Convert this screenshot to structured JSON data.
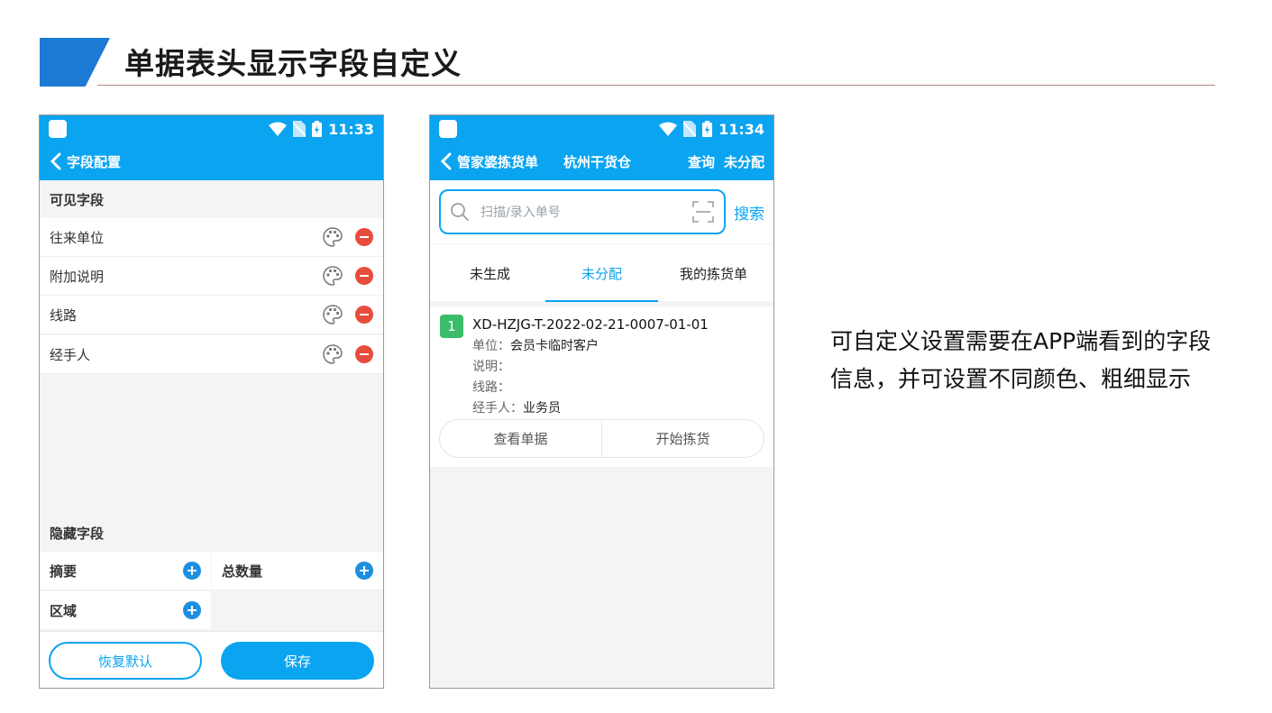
{
  "slide": {
    "title": "单据表头显示字段自定义",
    "description_line1": "可自定义设置需要在APP端看到的字段",
    "description_line2": "信息，并可设置不同颜色、粗细显示",
    "accent_color": "#1a7ad4"
  },
  "phone1": {
    "status_time": "11:33",
    "nav_title": "字段配置",
    "visible_section": "可见字段",
    "visible_fields": [
      {
        "label": "往来单位"
      },
      {
        "label": "附加说明"
      },
      {
        "label": "线路"
      },
      {
        "label": "经手人"
      }
    ],
    "hidden_section": "隐藏字段",
    "hidden_fields": [
      {
        "label": "摘要"
      },
      {
        "label": "总数量"
      },
      {
        "label": "区域"
      }
    ],
    "reset_label": "恢复默认",
    "save_label": "保存",
    "primary_color": "#0aa4f0"
  },
  "phone2": {
    "status_time": "11:34",
    "nav_title": "管家婆拣货单",
    "nav_warehouse": "杭州干货仓",
    "nav_query": "查询",
    "nav_filter": "未分配",
    "search_placeholder": "扫描/录入单号",
    "search_label": "搜索",
    "tabs": [
      {
        "label": "未生成"
      },
      {
        "label": "未分配"
      },
      {
        "label": "我的拣货单"
      }
    ],
    "active_tab": "未分配",
    "card": {
      "index": "1",
      "order_no": "XD-HZJG-T-2022-02-21-0007-01-01",
      "unit_label": "单位：",
      "unit_value": "会员卡临时客户",
      "note_label": "说明：",
      "note_value": "",
      "route_label": "线路：",
      "route_value": "",
      "handler_label": "经手人：",
      "handler_value": "业务员",
      "view_label": "查看单据",
      "start_label": "开始拣货"
    }
  }
}
